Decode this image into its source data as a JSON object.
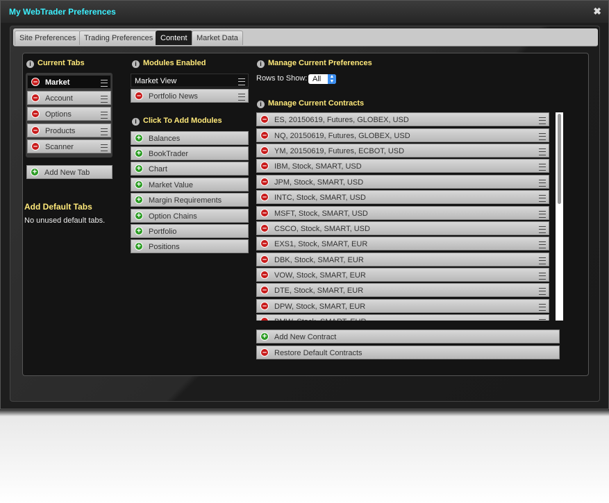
{
  "window": {
    "title": "My WebTrader Preferences"
  },
  "tabs": [
    {
      "label": "Site Preferences",
      "active": false
    },
    {
      "label": "Trading Preferences",
      "active": false
    },
    {
      "label": "Content",
      "active": true
    },
    {
      "label": "Market Data",
      "active": false
    }
  ],
  "current_tabs": {
    "header": "Current Tabs",
    "items": [
      "Market",
      "Account",
      "Options",
      "Products",
      "Scanner"
    ],
    "selected": "Market",
    "add_label": "Add New Tab"
  },
  "default_tabs": {
    "header": "Add Default Tabs",
    "message": "No unused default tabs."
  },
  "modules_enabled": {
    "header": "Modules Enabled",
    "items": [
      "Market View",
      "Portfolio News"
    ]
  },
  "add_modules": {
    "header": "Click To Add Modules",
    "items": [
      "Balances",
      "BookTrader",
      "Chart",
      "Market Value",
      "Margin Requirements",
      "Option Chains",
      "Portfolio",
      "Positions"
    ]
  },
  "preferences": {
    "header": "Manage Current Preferences",
    "rows_label": "Rows to Show:",
    "rows_value": "All"
  },
  "contracts": {
    "header": "Manage Current Contracts",
    "items": [
      "ES, 20150619, Futures, GLOBEX, USD",
      "NQ, 20150619, Futures, GLOBEX, USD",
      "YM, 20150619, Futures, ECBOT, USD",
      "IBM, Stock, SMART, USD",
      "JPM, Stock, SMART, USD",
      "INTC, Stock, SMART, USD",
      "MSFT, Stock, SMART, USD",
      "CSCO, Stock, SMART, USD",
      "EXS1, Stock, SMART, EUR",
      "DBK, Stock, SMART, EUR",
      "VOW, Stock, SMART, EUR",
      "DTE, Stock, SMART, EUR",
      "DPW, Stock, SMART, EUR",
      "BMW, Stock, SMART, EUR"
    ],
    "add_label": "Add New Contract",
    "restore_label": "Restore Default Contracts"
  },
  "colors": {
    "title": "#3df0ff",
    "header": "#ffe97a",
    "remove": "#c81b1b",
    "add": "#2b9b23"
  },
  "icons": {
    "info": "info-icon",
    "remove": "remove-icon",
    "add": "add-icon",
    "drag": "drag-handle-icon",
    "close": "close-icon"
  }
}
